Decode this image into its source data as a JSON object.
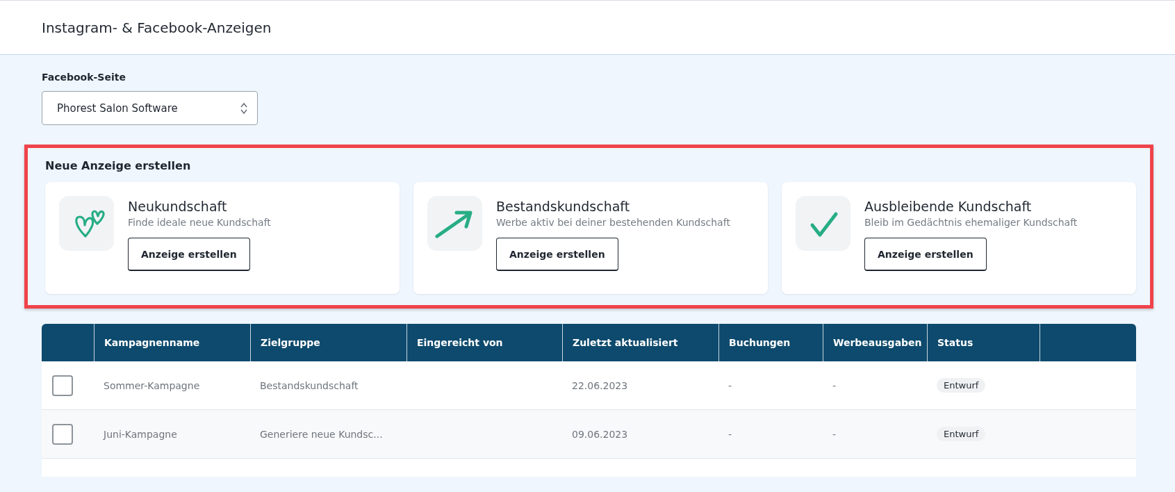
{
  "header": {
    "title": "Instagram- & Facebook-Anzeigen"
  },
  "page_select": {
    "label": "Facebook-Seite",
    "value": "Phorest Salon Software"
  },
  "create_section": {
    "title": "Neue Anzeige erstellen",
    "highlighted": true,
    "cards": [
      {
        "kind": "hearts",
        "title": "Neukundschaft",
        "subtitle": "Finde ideale neue Kundschaft",
        "button": "Anzeige erstellen"
      },
      {
        "kind": "arrow",
        "title": "Bestandskundschaft",
        "subtitle": "Werbe aktiv bei deiner bestehenden Kundschaft",
        "button": "Anzeige erstellen"
      },
      {
        "kind": "check",
        "title": "Ausbleibende Kundschaft",
        "subtitle": "Bleib im Gedächtnis ehemaliger Kundschaft",
        "button": "Anzeige erstellen"
      }
    ]
  },
  "table": {
    "columns": [
      "Kampagnenname",
      "Zielgruppe",
      "Eingereicht von",
      "Zuletzt aktualisiert",
      "Buchungen",
      "Werbeausgaben",
      "Status"
    ],
    "rows": [
      {
        "checked": false,
        "cells": [
          "Sommer-Kampagne",
          "Bestandskundschaft",
          "",
          "22.06.2023",
          "-",
          "-"
        ],
        "status": "Entwurf"
      },
      {
        "checked": false,
        "cells": [
          "Juni-Kampagne",
          "Generiere neue Kundsc...",
          "",
          "09.06.2023",
          "-",
          "-"
        ],
        "status": "Entwurf"
      }
    ]
  }
}
